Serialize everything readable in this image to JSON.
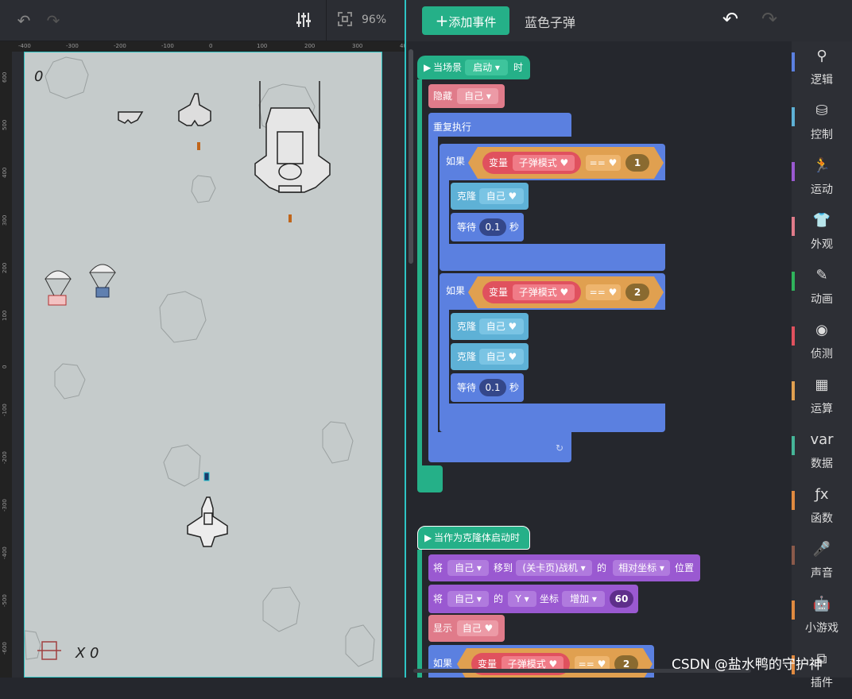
{
  "toolbar": {
    "zoom": "96%"
  },
  "ruler": {
    "x_ticks": [
      "-400",
      "-300",
      "-200",
      "-100",
      "0",
      "100",
      "200",
      "300",
      "40"
    ],
    "y_ticks": [
      "600",
      "500",
      "400",
      "300",
      "200",
      "100",
      "0",
      "-100",
      "-200",
      "-300",
      "-400",
      "-500",
      "-600"
    ]
  },
  "stage": {
    "score": "0",
    "lives_label": "X 0"
  },
  "header": {
    "add_event_label": "添加事件",
    "sprite_name": "蓝色子弹"
  },
  "palette": [
    {
      "label": "逻辑",
      "color": "#5b80e0"
    },
    {
      "label": "控制",
      "color": "#5eb1d6"
    },
    {
      "label": "运动",
      "color": "#9a59d1"
    },
    {
      "label": "外观",
      "color": "#e07b8a"
    },
    {
      "label": "动画",
      "color": "#2fb35b"
    },
    {
      "label": "侦测",
      "color": "#e0515e"
    },
    {
      "label": "运算",
      "color": "#e0a050"
    },
    {
      "label": "数据",
      "color": "#45b598"
    },
    {
      "label": "函数",
      "color": "#e08a40"
    },
    {
      "label": "声音",
      "color": "#8a5a4a"
    },
    {
      "label": "小游戏",
      "color": "#e08a40"
    },
    {
      "label": "插件",
      "color": "#e08a40"
    }
  ],
  "blocks": {
    "hat1": {
      "prefix": "当场景",
      "dropdown": "启动",
      "suffix": "时"
    },
    "hide": {
      "label": "隐藏",
      "target": "自己"
    },
    "repeat": {
      "label": "重复执行"
    },
    "if1": {
      "label": "如果",
      "var_label": "变量",
      "var_name": "子弹模式",
      "op": "==",
      "value": "1"
    },
    "clone1": {
      "label": "克隆",
      "target": "自己"
    },
    "wait1": {
      "label": "等待",
      "value": "0.1",
      "unit": "秒"
    },
    "if2": {
      "label": "如果",
      "var_label": "变量",
      "var_name": "子弹模式",
      "op": "==",
      "value": "2"
    },
    "clone2": {
      "label": "克隆",
      "target": "自己"
    },
    "clone3": {
      "label": "克隆",
      "target": "自己"
    },
    "wait2": {
      "label": "等待",
      "value": "0.1",
      "unit": "秒"
    },
    "hat2": {
      "label": "当作为克隆体启动时"
    },
    "move": {
      "label": "将",
      "target": "自己",
      "to": "移到",
      "dest": "(关卡页)战机",
      "of": "的",
      "coord": "相对坐标",
      "pos": "位置"
    },
    "ychange": {
      "label": "将",
      "target": "自己",
      "of": "的",
      "axis": "Y",
      "coord": "坐标",
      "mode": "增加",
      "value": "60"
    },
    "show": {
      "label": "显示",
      "target": "自己"
    },
    "if3": {
      "label": "如果",
      "var_label": "变量",
      "var_name": "子弹模式",
      "op": "==",
      "value": "2"
    }
  },
  "watermark": "CSDN @盐水鸭的守护神"
}
